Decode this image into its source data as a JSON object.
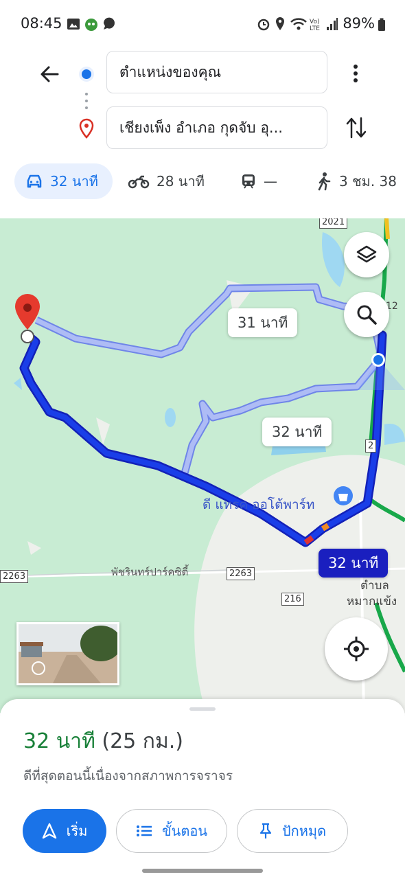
{
  "status_bar": {
    "time": "08:45",
    "battery": "89%"
  },
  "directions": {
    "origin": "ตำแหน่งของคุณ",
    "destination": "เชียงเพ็ง อำเภอ กุดจับ อุ..."
  },
  "travel_modes": [
    {
      "icon": "car-icon",
      "label": "32 นาที",
      "active": true
    },
    {
      "icon": "motorcycle-icon",
      "label": "28 นาที",
      "active": false
    },
    {
      "icon": "transit-icon",
      "label": "—",
      "active": false
    },
    {
      "icon": "walk-icon",
      "label": "3 ชม. 38",
      "active": false
    }
  ],
  "map": {
    "route_labels": {
      "main": "32 นาที",
      "alt1": "31 นาที",
      "alt2": "32 นาที"
    },
    "road_numbers": [
      "2021",
      "12",
      "2",
      "2263",
      "2263",
      "216"
    ],
    "places": {
      "shop": "ดี แทรค ออโต้พาร์ท",
      "park": "พัชรินทร์ปาร์คซิตี้",
      "subdistrict_line1": "ตำบล",
      "subdistrict_line2": "หมากแข้ง"
    },
    "colors": {
      "route": "#1a3ee8",
      "alt_route": "#a9b8f5",
      "water": "#9fd8f2",
      "land": "#c8ecd3"
    }
  },
  "summary": {
    "duration": "32 นาที",
    "distance": "(25 กม.)",
    "note": "ดีที่สุดตอนนี้เนื่องจากสภาพการจราจร",
    "buttons": {
      "start": "เริ่ม",
      "steps": "ขั้นตอน",
      "pin": "ปักหมุด"
    }
  }
}
